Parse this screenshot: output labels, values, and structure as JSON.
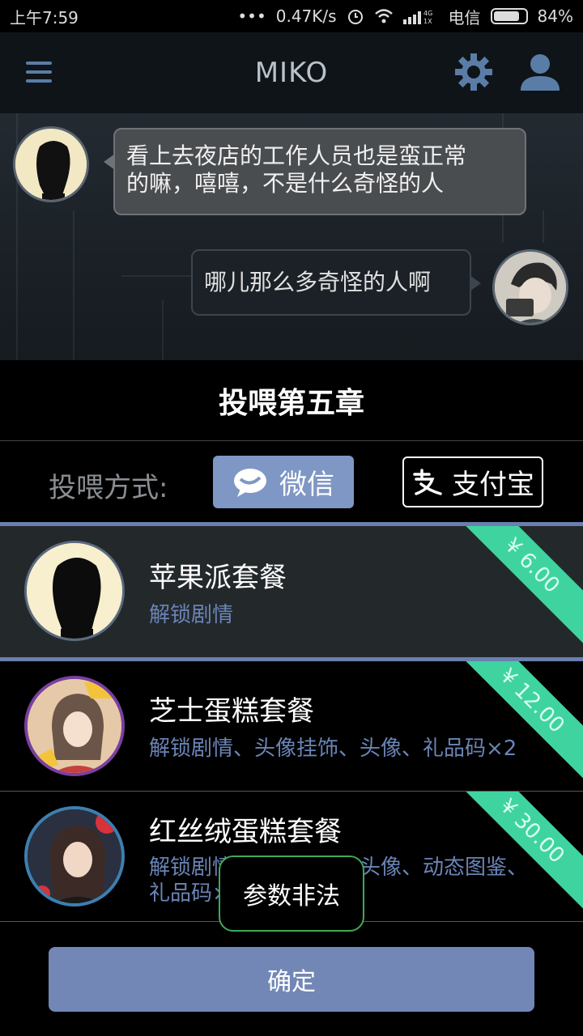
{
  "status_bar": {
    "time": "上午7:59",
    "dots": "•••",
    "network_speed": "0.47K/s",
    "carrier": "电信",
    "battery": "84%",
    "battery_level": 0.84
  },
  "header": {
    "title": "MIKO"
  },
  "chat": {
    "messages": [
      {
        "side": "left",
        "text_line1": "看上去夜店的工作人员也是蛮正常",
        "text_line2": "的嘛，嘻嘻，不是什么奇怪的人"
      },
      {
        "side": "right",
        "text": "哪儿那么多奇怪的人啊"
      }
    ]
  },
  "panel": {
    "title": "投喂第五章",
    "method_label": "投喂方式:",
    "methods": [
      {
        "label": "微信",
        "selected": true
      },
      {
        "label": "支付宝",
        "selected": false
      }
    ],
    "packages": [
      {
        "name": "苹果派套餐",
        "desc": "解锁剧情",
        "price": "¥ 6.00",
        "selected": true
      },
      {
        "name": "芝士蛋糕套餐",
        "desc": "解锁剧情、头像挂饰、头像、礼品码×2",
        "price": "¥ 12.00",
        "selected": false
      },
      {
        "name": "红丝绒蛋糕套餐",
        "desc_line1": "解锁剧情、头像挂饰、头像、动态图鉴、",
        "desc_line2": "礼品码×5",
        "price": "¥ 30.00",
        "selected": false
      }
    ],
    "toast": "参数非法",
    "confirm_label": "确定"
  },
  "colors": {
    "accent_blue": "#7f97c4",
    "price_green": "#3fd3a0",
    "toast_border": "#3faa58"
  }
}
